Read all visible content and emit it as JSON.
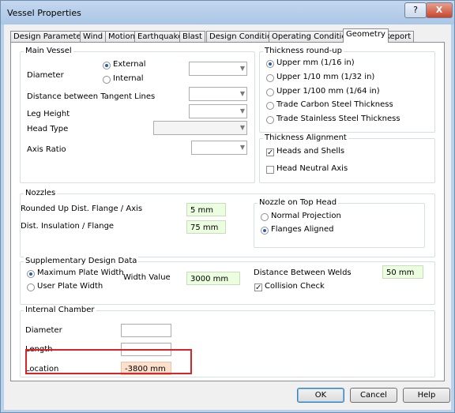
{
  "window": {
    "title": "Vessel Properties",
    "help_glyph": "?",
    "close_glyph": "X"
  },
  "tabs": [
    {
      "label": "Design Parameters"
    },
    {
      "label": "Wind"
    },
    {
      "label": "Motion"
    },
    {
      "label": "Earthquake"
    },
    {
      "label": "Blast"
    },
    {
      "label": "Design Conditions"
    },
    {
      "label": "Operating Conditions"
    },
    {
      "label": "Geometry",
      "active": true
    },
    {
      "label": "Report"
    }
  ],
  "main_vessel": {
    "title": "Main Vessel",
    "diameter_label": "Diameter",
    "external_label": "External",
    "internal_label": "Internal",
    "selected": "External",
    "tangent_label": "Distance between Tangent Lines",
    "leg_height_label": "Leg Height",
    "head_type_label": "Head Type",
    "axis_ratio_label": "Axis Ratio"
  },
  "thickness_roundup": {
    "title": "Thickness round-up",
    "options": [
      "Upper mm (1/16 in)",
      "Upper 1/10 mm (1/32 in)",
      "Upper 1/100 mm (1/64 in)",
      "Trade Carbon Steel Thickness",
      "Trade Stainless Steel Thickness"
    ],
    "selected_index": 0
  },
  "thickness_alignment": {
    "title": "Thickness Alignment",
    "heads_and_shells": "Heads and Shells",
    "heads_and_shells_checked": true,
    "head_neutral_axis": "Head Neutral Axis",
    "head_neutral_axis_checked": false
  },
  "nozzles": {
    "title": "Nozzles",
    "rounded_label": "Rounded Up Dist. Flange / Axis",
    "rounded_value": "5 mm",
    "insulation_label": "Dist. Insulation / Flange",
    "insulation_value": "75 mm"
  },
  "nozzle_top_head": {
    "title": "Nozzle on Top Head",
    "normal_projection": "Normal Projection",
    "flanges_aligned": "Flanges Aligned",
    "selected": "Flanges Aligned"
  },
  "supplementary": {
    "title": "Supplementary Design Data",
    "max_plate_width": "Maximum Plate Width",
    "user_plate_width": "User Plate Width",
    "selected": "Maximum Plate Width",
    "width_value_label": "Width Value",
    "width_value": "3000 mm",
    "distance_welds_label": "Distance Between Welds",
    "distance_welds_value": "50 mm",
    "collision_check": "Collision Check",
    "collision_check_checked": true
  },
  "internal_chamber": {
    "title": "Internal Chamber",
    "diameter_label": "Diameter",
    "diameter_value": "",
    "length_label": "Length",
    "length_value": "",
    "location_label": "Location",
    "location_value": "-3800 mm"
  },
  "buttons": {
    "ok": "OK",
    "cancel": "Cancel",
    "help": "Help"
  },
  "colors": {
    "highlight": "#d9242a",
    "green_field": "#ebffe0",
    "orange_field": "#fde0cc"
  }
}
